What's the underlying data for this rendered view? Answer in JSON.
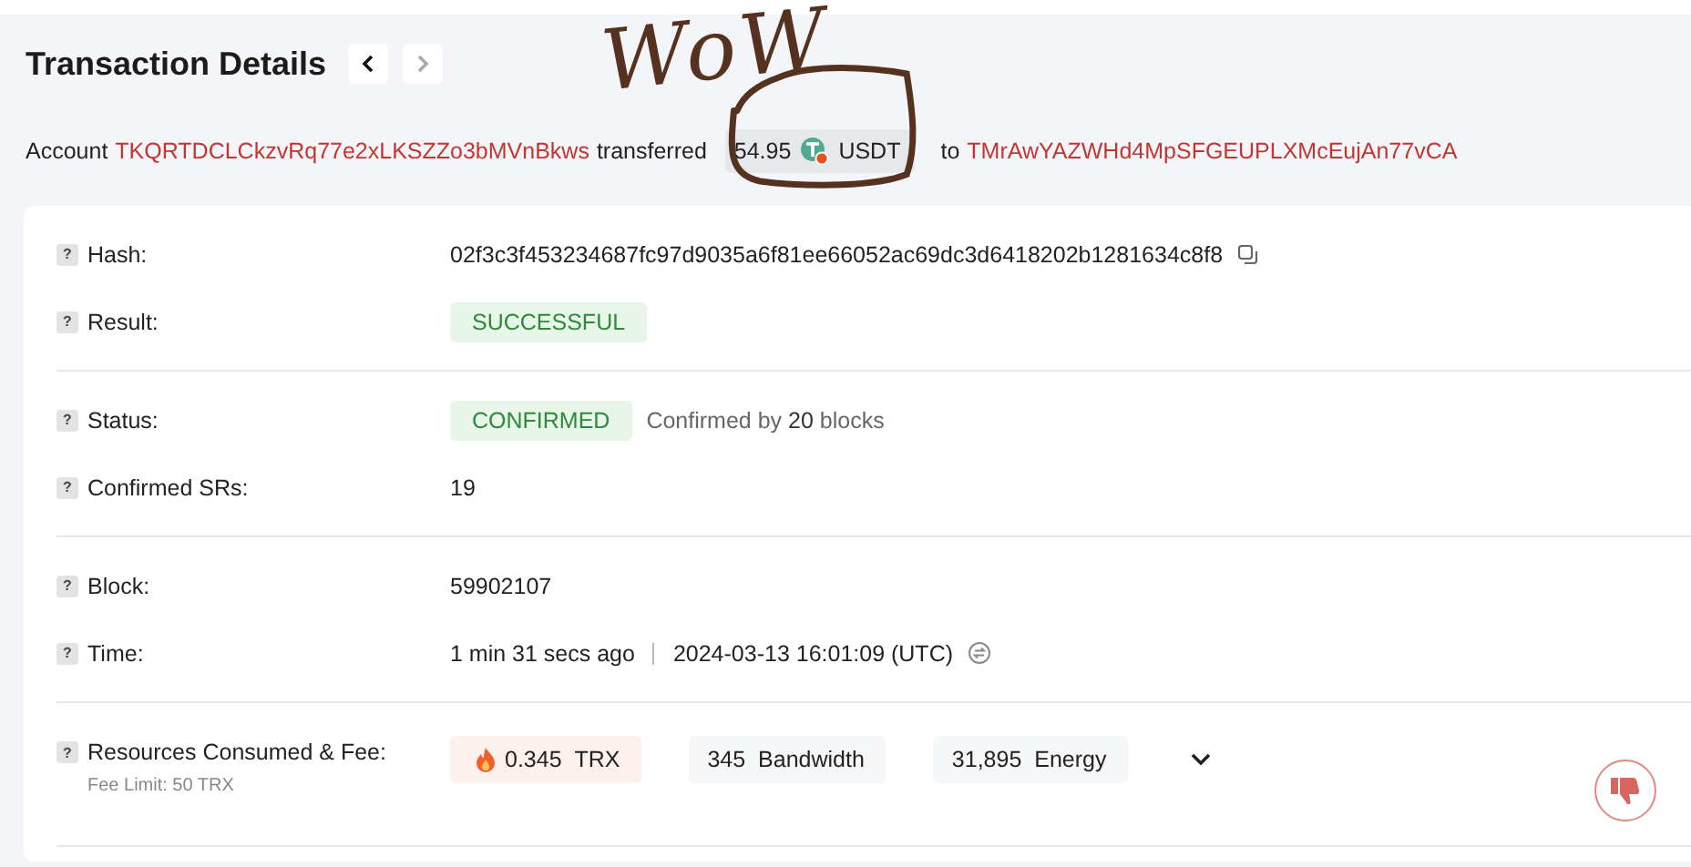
{
  "title": "Transaction Details",
  "nav": [
    {
      "kind": "prev",
      "disabled": false
    },
    {
      "kind": "next",
      "disabled": true
    }
  ],
  "summary": [
    {
      "kind": "text",
      "text": "Account"
    },
    {
      "kind": "link",
      "text": "TKQRTDCLCkzvRq77e2xLKSZZo3bMVnBkws"
    },
    {
      "kind": "text",
      "text": "transferred"
    },
    {
      "kind": "token",
      "amount": "54.95",
      "symbol": "USDT"
    },
    {
      "kind": "text",
      "text": "to"
    },
    {
      "kind": "link",
      "text": "TMrAwYAZWHd4MpSFGEUPLXMcEujAn77vCA"
    }
  ],
  "sections": [
    {
      "rows": [
        {
          "label": "Hash:",
          "kind": "hash",
          "value": "02f3c3f453234687fc97d9035a6f81ee66052ac69dc3d6418202b1281634c8f8"
        },
        {
          "label": "Result:",
          "kind": "badge",
          "value": "SUCCESSFUL"
        }
      ]
    },
    {
      "rows": [
        {
          "label": "Status:",
          "kind": "badge",
          "value": "CONFIRMED",
          "note": "Confirmed by **20** blocks"
        },
        {
          "label": "Confirmed SRs:",
          "kind": "plain",
          "value": "19"
        }
      ]
    },
    {
      "rows": [
        {
          "label": "Block:",
          "kind": "plain",
          "value": "59902107"
        },
        {
          "label": "Time:",
          "kind": "time",
          "value": "1 min 31 secs ago",
          "utc": "2024-03-13 16:01:09 (UTC)"
        }
      ]
    },
    {
      "rows": [
        {
          "label": "Resources Consumed & Fee:",
          "sublabel": "Fee Limit: 50 TRX",
          "kind": "resources",
          "chips": [
            {
              "kind": "fee",
              "value": "0.345",
              "unit": "TRX"
            },
            {
              "kind": "plain",
              "value": "345",
              "unit": "Bandwidth"
            },
            {
              "kind": "plain",
              "value": "31,895",
              "unit": "Energy"
            }
          ]
        }
      ]
    }
  ],
  "help": "?",
  "annotation": {
    "text": "WoW"
  }
}
